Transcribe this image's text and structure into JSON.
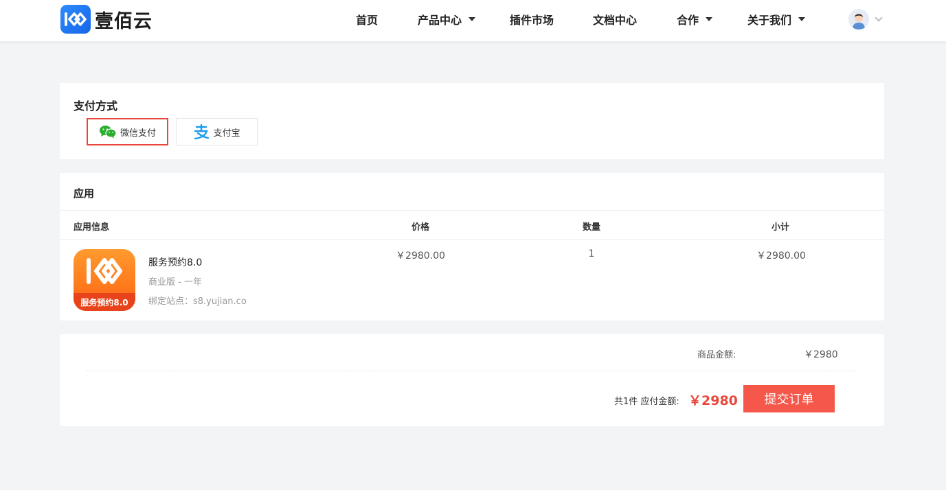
{
  "brand": {
    "name": "壹佰云",
    "accent": "#1a73f0"
  },
  "nav": {
    "items": [
      {
        "label": "首页",
        "dropdown": false
      },
      {
        "label": "产品中心",
        "dropdown": true
      },
      {
        "label": "插件市场",
        "dropdown": false
      },
      {
        "label": "文档中心",
        "dropdown": false
      },
      {
        "label": "合作",
        "dropdown": true
      },
      {
        "label": "关于我们",
        "dropdown": true
      }
    ]
  },
  "payment": {
    "title": "支付方式",
    "options": [
      {
        "label": "微信支付",
        "icon": "wechat-icon",
        "selected": true
      },
      {
        "label": "支付宝",
        "icon": "alipay-icon",
        "selected": false
      }
    ]
  },
  "app_section": {
    "title": "应用",
    "columns": [
      "应用信息",
      "价格",
      "数量",
      "小计"
    ],
    "rows": [
      {
        "name": "服务预约8.0",
        "edition": "商业版 - 一年",
        "site": "绑定站点：s8.yujian.co",
        "icon_label": "服务预约8.0",
        "price": "￥2980.00",
        "quantity": "1",
        "subtotal": "￥2980.00"
      }
    ]
  },
  "summary": {
    "goods_label": "商品金额:",
    "goods_value": "￥2980",
    "count_text": "共1件 应付金额:",
    "payable": "￥2980",
    "submit_label": "提交订单",
    "accent": "#e8483b"
  }
}
